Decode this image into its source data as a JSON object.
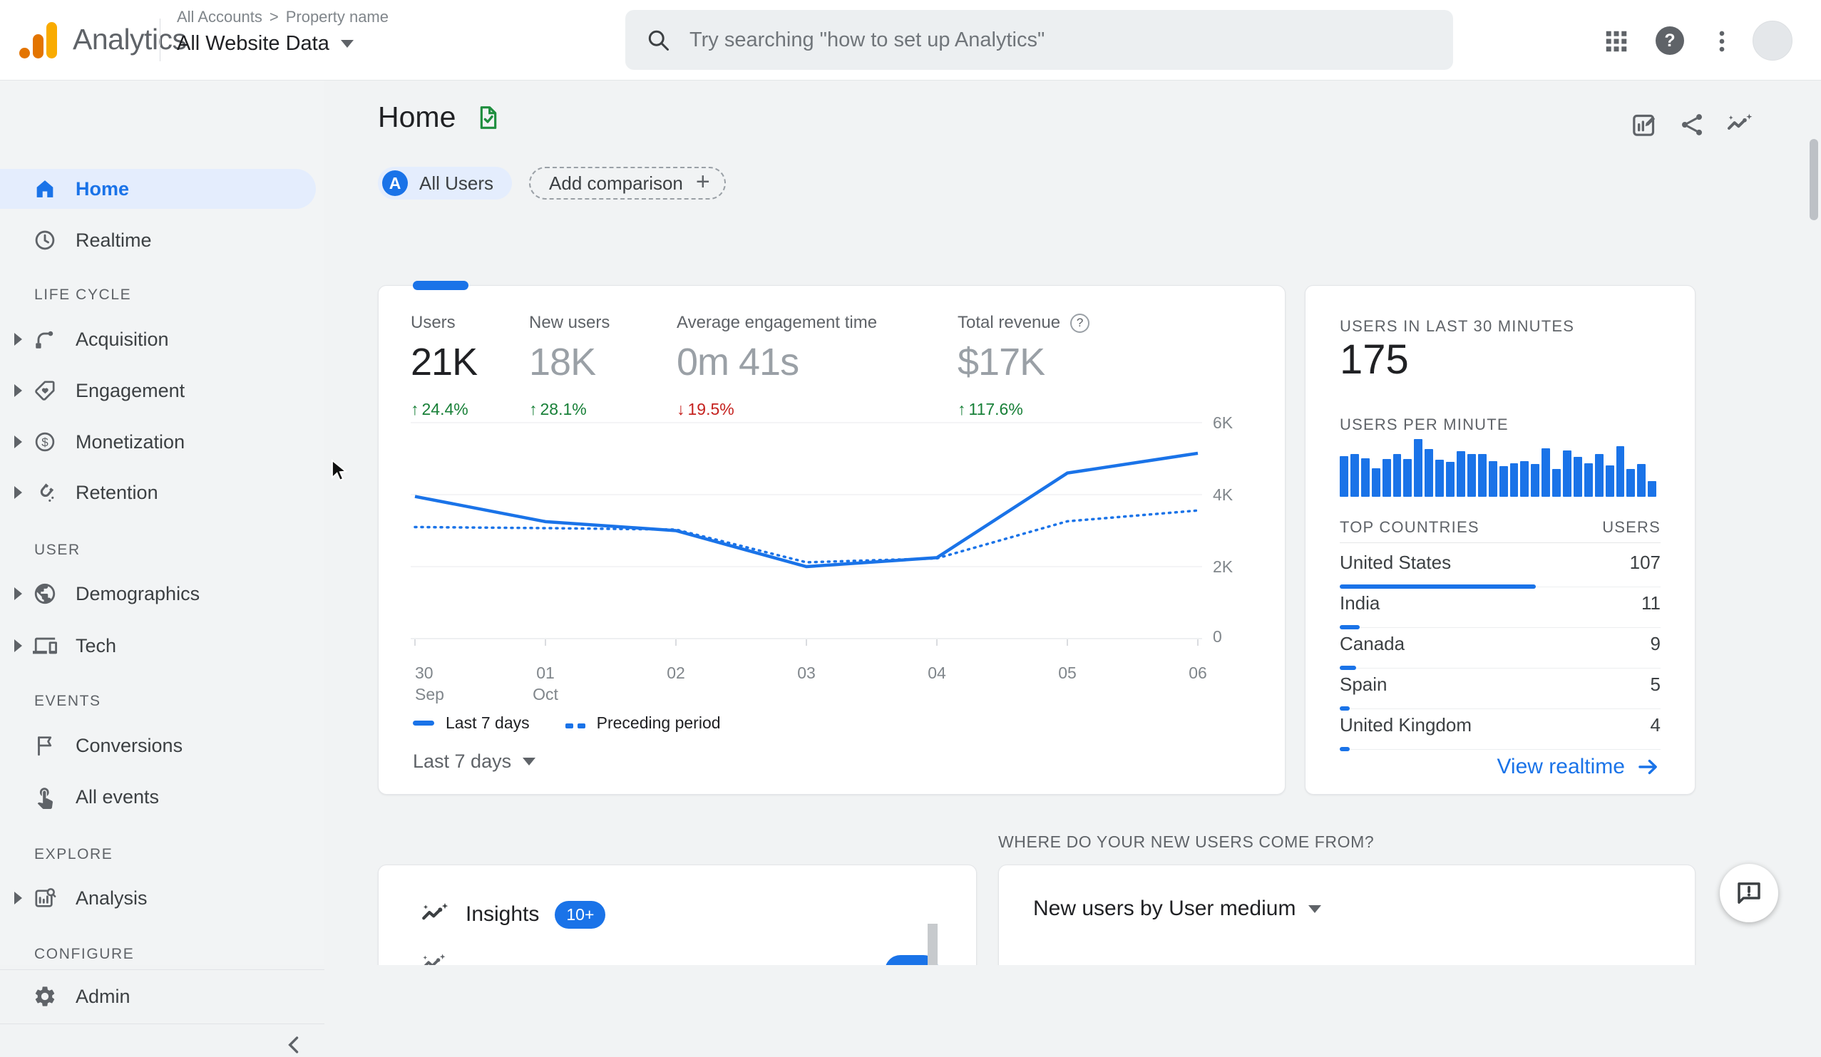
{
  "colors": {
    "accent": "#1a73e8",
    "positive": "#188038",
    "negative": "#c5221f",
    "logo_orange": "#e37400",
    "logo_yellow": "#f9ab00"
  },
  "topbar": {
    "brand": "Analytics",
    "breadcrumb_account": "All Accounts",
    "breadcrumb_sep": ">",
    "breadcrumb_property": "Property name",
    "property": "All Website Data",
    "search_placeholder": "Try searching \"how to set up Analytics\"",
    "help_glyph": "?"
  },
  "sidebar": {
    "primary": [
      {
        "label": "Home",
        "active": true
      },
      {
        "label": "Realtime",
        "active": false
      }
    ],
    "sections": [
      {
        "title": "LIFE CYCLE",
        "items": [
          {
            "label": "Acquisition",
            "expandable": true
          },
          {
            "label": "Engagement",
            "expandable": true
          },
          {
            "label": "Monetization",
            "expandable": true
          },
          {
            "label": "Retention",
            "expandable": true
          }
        ]
      },
      {
        "title": "USER",
        "items": [
          {
            "label": "Demographics",
            "expandable": true
          },
          {
            "label": "Tech",
            "expandable": true
          }
        ]
      },
      {
        "title": "EVENTS",
        "items": [
          {
            "label": "Conversions",
            "expandable": false
          },
          {
            "label": "All events",
            "expandable": false
          }
        ]
      },
      {
        "title": "EXPLORE",
        "items": [
          {
            "label": "Analysis",
            "expandable": true
          }
        ]
      },
      {
        "title": "CONFIGURE",
        "items": [
          {
            "label": "Admin",
            "expandable": false
          }
        ]
      }
    ]
  },
  "page": {
    "title": "Home",
    "chip_avatar": "A",
    "all_users_chip": "All Users",
    "add_comparison": "Add comparison"
  },
  "metrics": [
    {
      "label": "Users",
      "value": "21K",
      "delta": "24.4%",
      "direction": "up",
      "primary": true
    },
    {
      "label": "New users",
      "value": "18K",
      "delta": "28.1%",
      "direction": "up",
      "primary": false
    },
    {
      "label": "Average engagement time",
      "value": "0m 41s",
      "delta": "19.5%",
      "direction": "down",
      "primary": false
    },
    {
      "label": "Total revenue",
      "value": "$17K",
      "delta": "117.6%",
      "direction": "up",
      "primary": false,
      "has_help": true
    }
  ],
  "trend": {
    "legend": [
      "Last 7 days",
      "Preceding period"
    ],
    "range_label": "Last 7 days"
  },
  "chart_data": [
    {
      "type": "line",
      "title": "Users, last 7 days vs preceding period",
      "x_ticks": [
        {
          "t": "30",
          "s": "Sep"
        },
        {
          "t": "01",
          "s": "Oct"
        },
        {
          "t": "02",
          "s": ""
        },
        {
          "t": "03",
          "s": ""
        },
        {
          "t": "04",
          "s": ""
        },
        {
          "t": "05",
          "s": ""
        },
        {
          "t": "06",
          "s": ""
        }
      ],
      "y_ticks": [
        "6K",
        "4K",
        "2K",
        "0"
      ],
      "ylim": [
        0,
        6000
      ],
      "grid": true,
      "legend_position": "bottom",
      "series": [
        {
          "name": "Last 7 days",
          "style": "solid",
          "values": [
            3950,
            3250,
            3000,
            2000,
            2250,
            4600,
            5150
          ]
        },
        {
          "name": "Preceding period",
          "style": "dashed",
          "values": [
            3100,
            3070,
            3030,
            2120,
            2230,
            3260,
            3560
          ]
        }
      ]
    },
    {
      "type": "bar",
      "title": "Users per minute",
      "values": [
        68,
        72,
        64,
        48,
        63,
        71,
        63,
        97,
        80,
        62,
        58,
        76,
        71,
        71,
        59,
        51,
        56,
        59,
        55,
        81,
        46,
        77,
        67,
        56,
        71,
        52,
        85,
        46,
        55,
        26
      ]
    },
    {
      "type": "table",
      "title": "Top countries by users in last 30 minutes",
      "columns": [
        "TOP COUNTRIES",
        "USERS"
      ],
      "rows": [
        [
          "United States",
          107
        ],
        [
          "India",
          11
        ],
        [
          "Canada",
          9
        ],
        [
          "Spain",
          5
        ],
        [
          "United Kingdom",
          4
        ]
      ]
    }
  ],
  "realtime": {
    "users_30min_label": "USERS IN LAST 30 MINUTES",
    "users_30min": "175",
    "per_minute_label": "USERS PER MINUTE",
    "countries_label": "TOP COUNTRIES",
    "users_col_label": "USERS",
    "view_realtime": "View realtime"
  },
  "insights": {
    "title": "Insights",
    "badge": "10+"
  },
  "new_users": {
    "question": "WHERE DO YOUR NEW USERS COME FROM?",
    "selector": "New users by User medium"
  }
}
